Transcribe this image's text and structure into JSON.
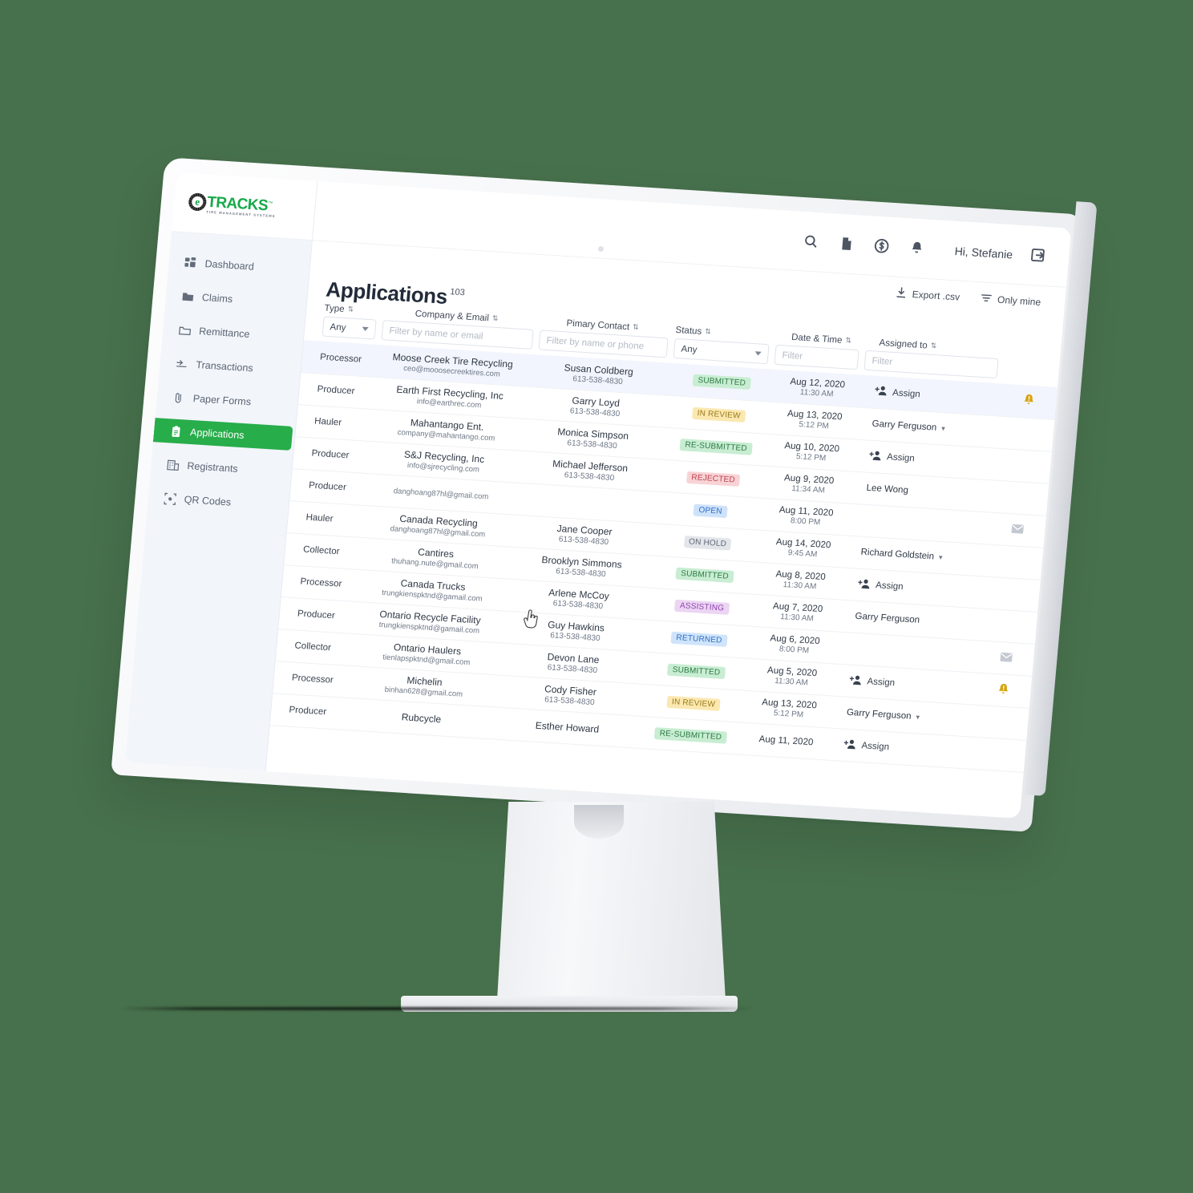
{
  "colors": {
    "background": "#47704c",
    "brand_green": "#27ad4a",
    "logo_green": "#17a94a",
    "row_hover": "#f2f5fd",
    "sidebar_bg": "#f2f5fa",
    "alert_amber": "#d6a310"
  },
  "brand": {
    "logo_letter": "e",
    "logo_name": "TRACKS",
    "logo_tm": "™",
    "logo_tagline": "TIRE MANAGEMENT SYSTEMS"
  },
  "topbar": {
    "greeting": "Hi, Stefanie",
    "icons": [
      "search-icon",
      "document-icon",
      "dollar-circle-icon",
      "bell-icon"
    ],
    "logout_icon": "logout-icon"
  },
  "sidebar": {
    "items": [
      {
        "label": "Dashboard",
        "icon": "grid-icon",
        "active": false
      },
      {
        "label": "Claims",
        "icon": "folder-solid-icon",
        "active": false
      },
      {
        "label": "Remittance",
        "icon": "folder-open-icon",
        "active": false
      },
      {
        "label": "Transactions",
        "icon": "arrows-icon",
        "active": false
      },
      {
        "label": "Paper Forms",
        "icon": "paperclip-icon",
        "active": false
      },
      {
        "label": "Applications",
        "icon": "clipboard-icon",
        "active": true
      },
      {
        "label": "Registrants",
        "icon": "building-icon",
        "active": false
      },
      {
        "label": "QR Codes",
        "icon": "qr-icon",
        "active": false
      }
    ]
  },
  "action_bar": {
    "export_label": "Export .csv",
    "export_icon": "download-icon",
    "only_mine_label": "Only mine",
    "only_mine_icon": "filter-icon"
  },
  "page": {
    "title": "Applications",
    "count": "103"
  },
  "table": {
    "columns": [
      {
        "key": "type",
        "label": "Type",
        "sortable": true
      },
      {
        "key": "company",
        "label": "Company & Email",
        "sortable": true
      },
      {
        "key": "contact",
        "label": "Pimary Contact",
        "sortable": true
      },
      {
        "key": "status",
        "label": "Status",
        "sortable": true
      },
      {
        "key": "date",
        "label": "Date & Time",
        "sortable": true
      },
      {
        "key": "assigned",
        "label": "Assigned to",
        "sortable": true
      },
      {
        "key": "flag",
        "label": "",
        "sortable": false
      }
    ],
    "filters": {
      "type_value": "Any",
      "company_placeholder": "Filter by name or email",
      "contact_placeholder": "Filter by name or phone",
      "status_value": "Any",
      "date_placeholder": "Filter",
      "assigned_placeholder": "Filter"
    },
    "rows": [
      {
        "type": "Processor",
        "company": "Moose Creek Tire Recycling",
        "email": "ceo@mooosecreektires.com",
        "contact": "Susan Coldberg",
        "phone": "613-538-4830",
        "status": "SUBMITTED",
        "status_class": "b-submitted",
        "date": "Aug 12, 2020",
        "time": "11:30 AM",
        "assigned": "",
        "assign_label": "Assign",
        "assign_chevron": false,
        "flag": "bell-alert-icon",
        "hovered": true
      },
      {
        "type": "Producer",
        "company": "Earth First Recycling, Inc",
        "email": "info@earthrec.com",
        "contact": "Garry Loyd",
        "phone": "613-538-4830",
        "status": "IN REVIEW",
        "status_class": "b-inreview",
        "date": "Aug 13, 2020",
        "time": "5:12 PM",
        "assigned": "Garry Ferguson",
        "assign_label": "",
        "assign_chevron": true,
        "flag": "",
        "hovered": false
      },
      {
        "type": "Hauler",
        "company": "Mahantango Ent.",
        "email": "company@mahantango.com",
        "contact": "Monica Simpson",
        "phone": "613-538-4830",
        "status": "RE-SUBMITTED",
        "status_class": "b-resubmitted",
        "date": "Aug 10, 2020",
        "time": "5:12 PM",
        "assigned": "",
        "assign_label": "Assign",
        "assign_chevron": false,
        "flag": "",
        "hovered": false
      },
      {
        "type": "Producer",
        "company": "S&J Recycling, Inc",
        "email": "info@sjrecycling.com",
        "contact": "Michael Jefferson",
        "phone": "613-538-4830",
        "status": "REJECTED",
        "status_class": "b-rejected",
        "date": "Aug 9, 2020",
        "time": "11:34 AM",
        "assigned": "Lee Wong",
        "assign_label": "",
        "assign_chevron": false,
        "flag": "",
        "hovered": false
      },
      {
        "type": "Producer",
        "company": "",
        "email": "danghoang87hl@gmail.com",
        "contact": "",
        "phone": "",
        "status": "OPEN",
        "status_class": "b-open",
        "date": "Aug 11, 2020",
        "time": "8:00 PM",
        "assigned": "",
        "assign_label": "",
        "assign_chevron": false,
        "flag": "envelope-icon",
        "hovered": false
      },
      {
        "type": "Hauler",
        "company": "Canada Recycling",
        "email": "danghoang87hl@gmail.com",
        "contact": "Jane Cooper",
        "phone": "613-538-4830",
        "status": "ON HOLD",
        "status_class": "b-onhold",
        "date": "Aug 14, 2020",
        "time": "9:45 AM",
        "assigned": "Richard Goldstein",
        "assign_label": "",
        "assign_chevron": true,
        "flag": "",
        "hovered": false
      },
      {
        "type": "Collector",
        "company": "Cantires",
        "email": "thuhang.nute@gmail.com",
        "contact": "Brooklyn Simmons",
        "phone": "613-538-4830",
        "status": "SUBMITTED",
        "status_class": "b-submitted",
        "date": "Aug 8, 2020",
        "time": "11:30 AM",
        "assigned": "",
        "assign_label": "Assign",
        "assign_chevron": false,
        "flag": "",
        "hovered": false
      },
      {
        "type": "Processor",
        "company": "Canada Trucks",
        "email": "trungkienspktnd@gamail.com",
        "contact": "Arlene McCoy",
        "phone": "613-538-4830",
        "status": "ASSISTING",
        "status_class": "b-assisting",
        "date": "Aug 7, 2020",
        "time": "11:30 AM",
        "assigned": "Garry Ferguson",
        "assign_label": "",
        "assign_chevron": false,
        "flag": "",
        "hovered": false
      },
      {
        "type": "Producer",
        "company": "Ontario Recycle Facility",
        "email": "trungkienspktnd@gamail.com",
        "contact": "Guy Hawkins",
        "phone": "613-538-4830",
        "status": "RETURNED",
        "status_class": "b-returned",
        "date": "Aug 6, 2020",
        "time": "8:00 PM",
        "assigned": "",
        "assign_label": "",
        "assign_chevron": false,
        "flag": "envelope-icon",
        "hovered": false
      },
      {
        "type": "Collector",
        "company": "Ontario Haulers",
        "email": "tienlapspktnd@gmail.com",
        "contact": "Devon Lane",
        "phone": "613-538-4830",
        "status": "SUBMITTED",
        "status_class": "b-submitted",
        "date": "Aug 5, 2020",
        "time": "11:30 AM",
        "assigned": "",
        "assign_label": "Assign",
        "assign_chevron": false,
        "flag": "bell-alert-icon",
        "hovered": false
      },
      {
        "type": "Processor",
        "company": "Michelin",
        "email": "binhan628@gmail.com",
        "contact": "Cody Fisher",
        "phone": "613-538-4830",
        "status": "IN REVIEW",
        "status_class": "b-inreview",
        "date": "Aug 13, 2020",
        "time": "5:12 PM",
        "assigned": "Garry Ferguson",
        "assign_label": "",
        "assign_chevron": true,
        "flag": "",
        "hovered": false
      },
      {
        "type": "Producer",
        "company": "Rubcycle",
        "email": "",
        "contact": "Esther Howard",
        "phone": "",
        "status": "RE-SUBMITTED",
        "status_class": "b-resubmitted",
        "date": "Aug 11, 2020",
        "time": "",
        "assigned": "",
        "assign_label": "Assign",
        "assign_chevron": false,
        "flag": "",
        "hovered": false
      }
    ]
  },
  "cursor": {
    "icon": "pointing-hand-cursor"
  }
}
